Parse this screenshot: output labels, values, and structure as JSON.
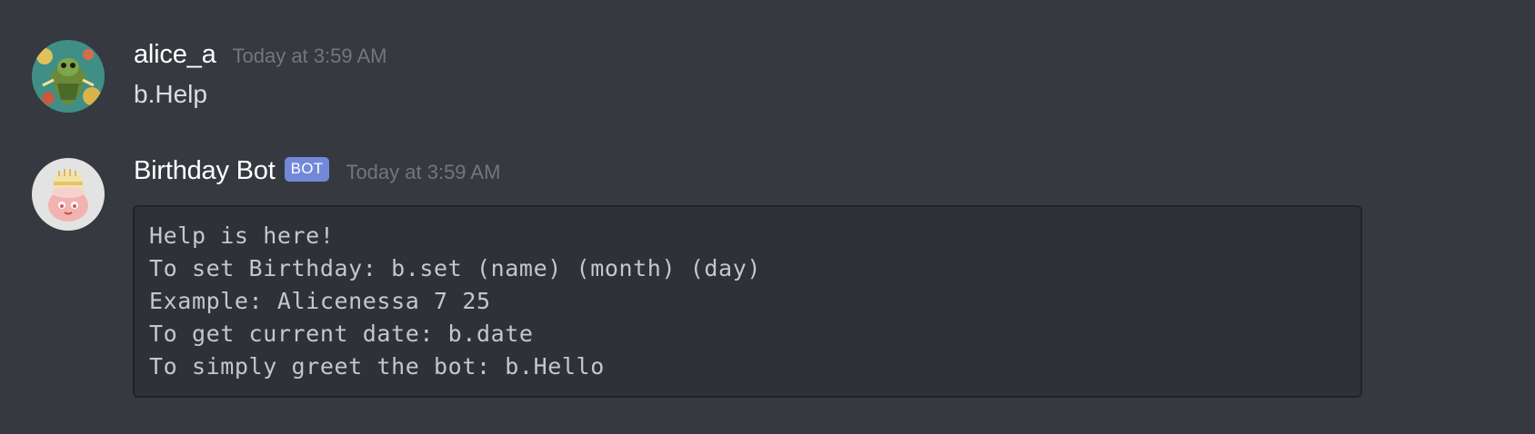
{
  "messages": [
    {
      "username": "alice_a",
      "timestamp": "Today at 3:59 AM",
      "text": "b.Help"
    },
    {
      "username": "Birthday Bot",
      "badge": "BOT",
      "timestamp": "Today at 3:59 AM",
      "code_lines": [
        "Help is here!",
        "To set Birthday: b.set (name) (month) (day)",
        "Example: Alicenessa 7 25",
        "To get current date: b.date",
        "To simply greet the bot: b.Hello"
      ]
    }
  ],
  "colors": {
    "background": "#36393f",
    "code_background": "#2f3136",
    "bot_badge": "#7289da",
    "timestamp": "#72767d"
  },
  "icons": {
    "user_avatar": "frog-figure-avatar-icon",
    "bot_avatar": "birthday-cake-avatar-icon"
  }
}
